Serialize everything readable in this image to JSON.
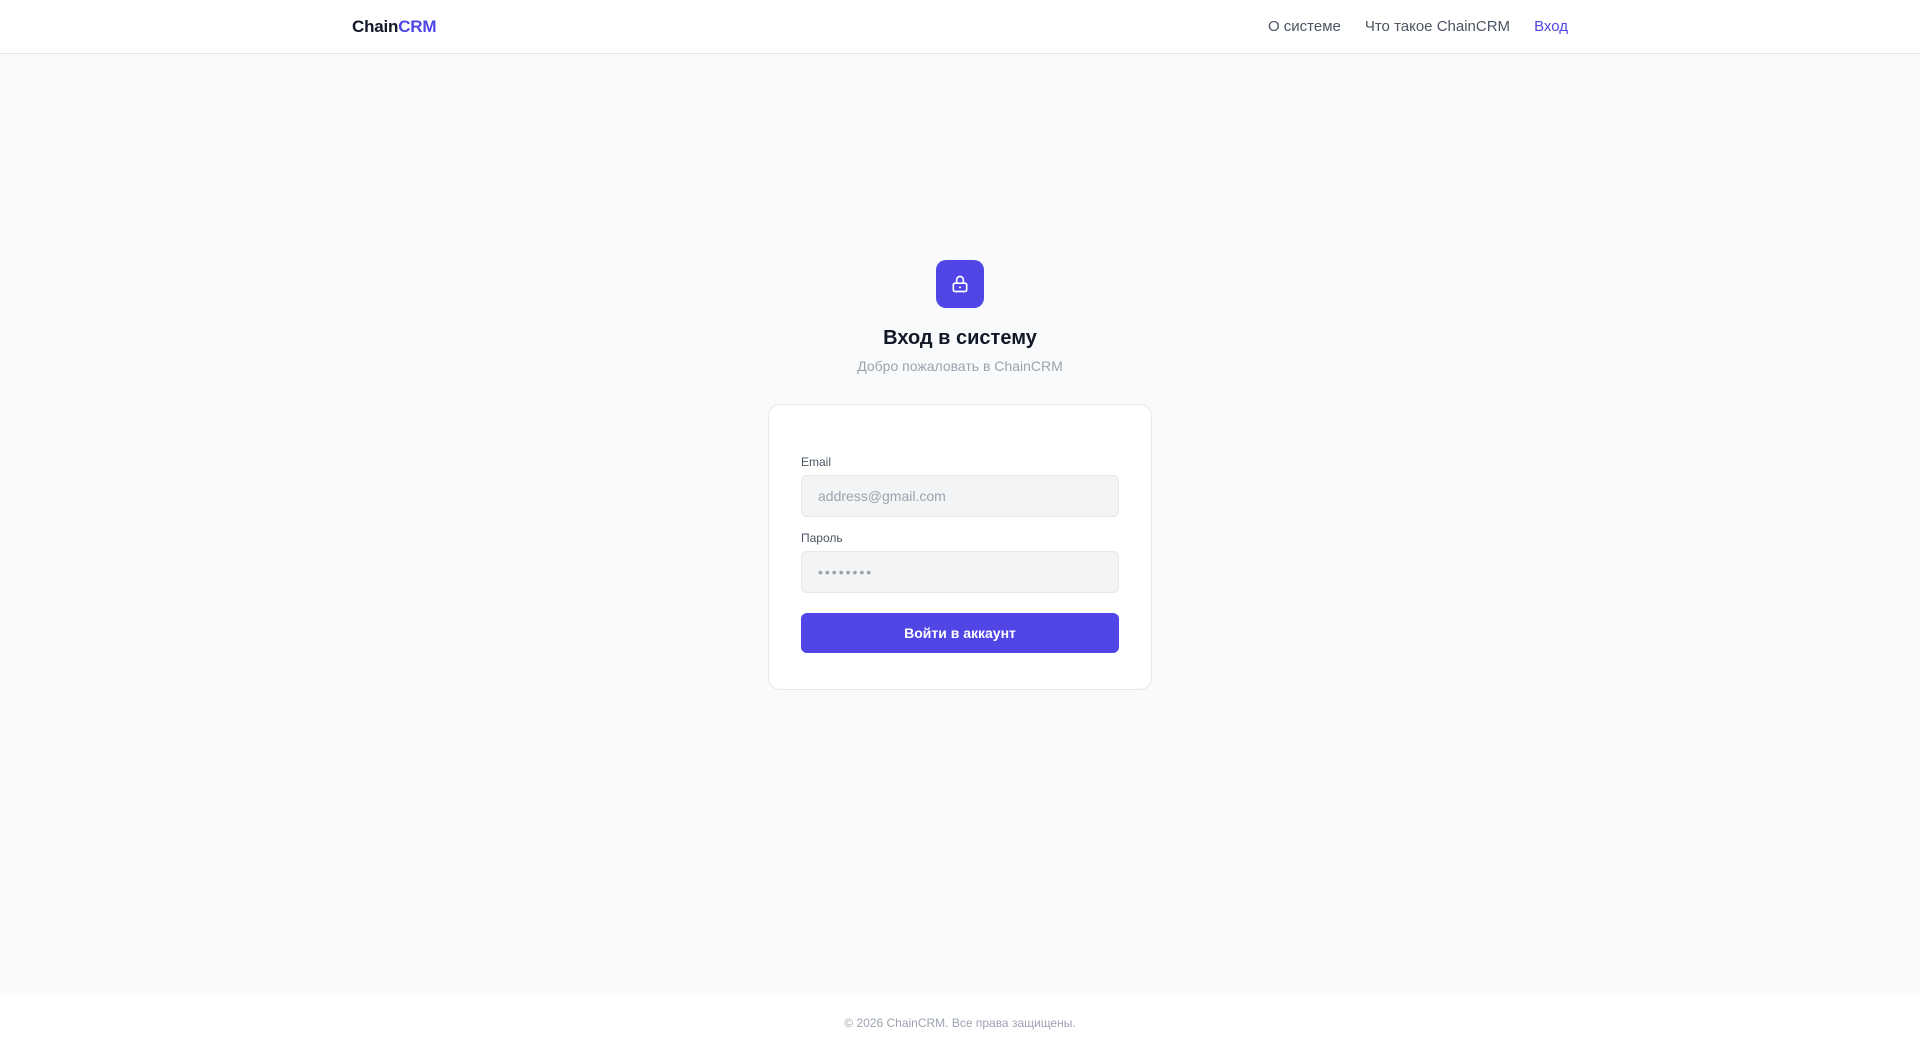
{
  "header": {
    "logo": {
      "part1": "Chain",
      "part2": "CRM"
    },
    "nav": [
      {
        "label": "О системе"
      },
      {
        "label": "Что такое ChainCRM"
      },
      {
        "label": "Вход",
        "active": true
      }
    ]
  },
  "hero": {
    "icon": "lock-icon",
    "title": "Вход в систему",
    "subtitle": "Добро пожаловать в ChainCRM"
  },
  "form": {
    "email": {
      "label": "Email",
      "placeholder": "address@gmail.com",
      "value": ""
    },
    "password": {
      "label": "Пароль",
      "placeholder": "••••••••",
      "value": ""
    },
    "submit_label": "Войти в аккаунт"
  },
  "footer": {
    "text": "© 2026 ChainCRM. Все права защищены."
  },
  "colors": {
    "accent": "#4f46e5",
    "background": "#f9fafb",
    "text": "#111827",
    "muted": "#9ca3af"
  }
}
